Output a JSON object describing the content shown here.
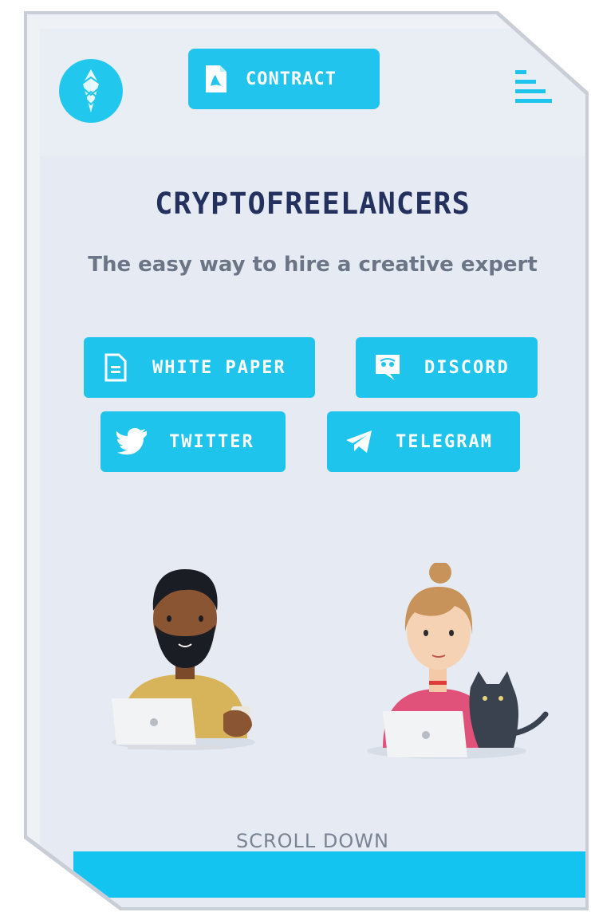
{
  "header": {
    "contract_label": "CONTRACT"
  },
  "hero": {
    "title": "CRYPTOFREELANCERS",
    "subtitle": "The easy way to hire a creative expert"
  },
  "links": {
    "white_paper": "WHITE PAPER",
    "discord": "DISCORD",
    "twitter": "TWITTER",
    "telegram": "TELEGRAM"
  },
  "footer": {
    "scroll_label": "SCROLL DOWN"
  },
  "colors": {
    "accent": "#1ec4ec",
    "background": "#e6ebf3",
    "title": "#24305e",
    "subtitle": "#6b7585"
  },
  "icons": [
    "logo-icon",
    "pdf-icon",
    "menu-icon",
    "document-icon",
    "discord-icon",
    "twitter-icon",
    "telegram-icon"
  ]
}
